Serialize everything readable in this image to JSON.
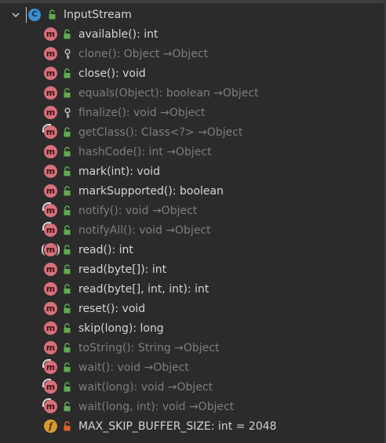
{
  "class_node": {
    "name": "InputStream",
    "icon": "abstract-class-icon",
    "icon_letter": "C",
    "visibility": "public"
  },
  "members": [
    {
      "label": "available(): int",
      "kind": "method",
      "icon_letter": "m",
      "visibility": "public",
      "inherited": false
    },
    {
      "label": "clone(): Object →Object",
      "kind": "method",
      "icon_letter": "m",
      "visibility": "protected",
      "inherited": true
    },
    {
      "label": "close(): void",
      "kind": "method",
      "icon_letter": "m",
      "visibility": "public",
      "inherited": false
    },
    {
      "label": "equals(Object): boolean →Object",
      "kind": "method",
      "icon_letter": "m",
      "visibility": "public",
      "inherited": true
    },
    {
      "label": "finalize(): void →Object",
      "kind": "method",
      "icon_letter": "m",
      "visibility": "protected",
      "inherited": true
    },
    {
      "label": "getClass(): Class<?> →Object",
      "kind": "method-override",
      "icon_letter": "m",
      "visibility": "public",
      "inherited": true
    },
    {
      "label": "hashCode(): int →Object",
      "kind": "method",
      "icon_letter": "m",
      "visibility": "public",
      "inherited": true
    },
    {
      "label": "mark(int): void",
      "kind": "method",
      "icon_letter": "m",
      "visibility": "public",
      "inherited": false
    },
    {
      "label": "markSupported(): boolean",
      "kind": "method",
      "icon_letter": "m",
      "visibility": "public",
      "inherited": false
    },
    {
      "label": "notify(): void →Object",
      "kind": "method-override",
      "icon_letter": "m",
      "visibility": "public",
      "inherited": true
    },
    {
      "label": "notifyAll(): void →Object",
      "kind": "method-override",
      "icon_letter": "m",
      "visibility": "public",
      "inherited": true
    },
    {
      "label": "read(): int",
      "kind": "method-abstract",
      "icon_letter": "m",
      "visibility": "public",
      "inherited": false
    },
    {
      "label": "read(byte[]): int",
      "kind": "method",
      "icon_letter": "m",
      "visibility": "public",
      "inherited": false
    },
    {
      "label": "read(byte[], int, int): int",
      "kind": "method",
      "icon_letter": "m",
      "visibility": "public",
      "inherited": false
    },
    {
      "label": "reset(): void",
      "kind": "method",
      "icon_letter": "m",
      "visibility": "public",
      "inherited": false
    },
    {
      "label": "skip(long): long",
      "kind": "method",
      "icon_letter": "m",
      "visibility": "public",
      "inherited": false
    },
    {
      "label": "toString(): String →Object",
      "kind": "method",
      "icon_letter": "m",
      "visibility": "public",
      "inherited": true
    },
    {
      "label": "wait(): void →Object",
      "kind": "method-override",
      "icon_letter": "m",
      "visibility": "public",
      "inherited": true
    },
    {
      "label": "wait(long): void →Object",
      "kind": "method-override",
      "icon_letter": "m",
      "visibility": "public",
      "inherited": true
    },
    {
      "label": "wait(long, int): void →Object",
      "kind": "method-override",
      "icon_letter": "m",
      "visibility": "public",
      "inherited": true
    },
    {
      "label": "MAX_SKIP_BUFFER_SIZE: int = 2048",
      "kind": "field",
      "icon_letter": "f",
      "visibility": "private",
      "inherited": false
    }
  ],
  "colors": {
    "background": "#2b2b2b",
    "text": "#d4d4d4",
    "inherited_text": "#7a7e80",
    "method_icon": "#d7707a",
    "field_icon": "#d69a35",
    "class_icon": "#3a8fd0",
    "public_lock": "#5fad4e",
    "private_lock": "#d9622b"
  }
}
